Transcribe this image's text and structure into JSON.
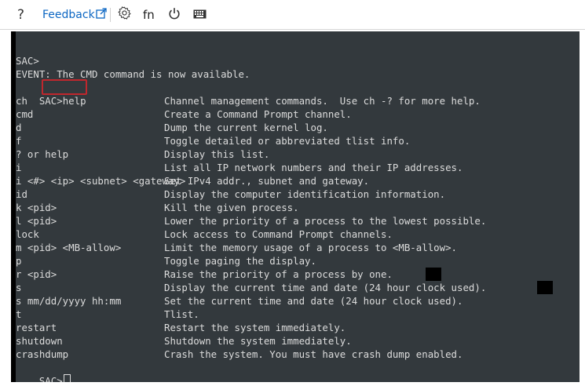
{
  "toolbar": {
    "help_label": "?",
    "feedback_label": "Feedback",
    "fn_label": "fn"
  },
  "terminal": {
    "pre_lines": [
      "SAC>",
      "EVENT: The CMD command is now available."
    ],
    "prompt": "SAC>",
    "typed_command": "help",
    "help_rows": [
      {
        "cmd": "ch",
        "desc": "Channel management commands.  Use ch -? for more help."
      },
      {
        "cmd": "cmd",
        "desc": "Create a Command Prompt channel."
      },
      {
        "cmd": "d",
        "desc": "Dump the current kernel log."
      },
      {
        "cmd": "f",
        "desc": "Toggle detailed or abbreviated tlist info."
      },
      {
        "cmd": "? or help",
        "desc": "Display this list."
      },
      {
        "cmd": "i",
        "desc": "List all IP network numbers and their IP addresses."
      },
      {
        "cmd": "i <#> <ip> <subnet> <gateway>",
        "desc": "Set IPv4 addr., subnet and gateway."
      },
      {
        "cmd": "id",
        "desc": "Display the computer identification information."
      },
      {
        "cmd": "k <pid>",
        "desc": "Kill the given process."
      },
      {
        "cmd": "l <pid>",
        "desc": "Lower the priority of a process to the lowest possible."
      },
      {
        "cmd": "lock",
        "desc": "Lock access to Command Prompt channels."
      },
      {
        "cmd": "m <pid> <MB-allow>",
        "desc": "Limit the memory usage of a process to <MB-allow>."
      },
      {
        "cmd": "p",
        "desc": "Toggle paging the display."
      },
      {
        "cmd": "r <pid>",
        "desc": "Raise the priority of a process by one."
      },
      {
        "cmd": "s",
        "desc": "Display the current time and date (24 hour clock used)."
      },
      {
        "cmd": "s mm/dd/yyyy hh:mm",
        "desc": "Set the current time and date (24 hour clock used)."
      },
      {
        "cmd": "t",
        "desc": "Tlist."
      },
      {
        "cmd": "restart",
        "desc": "Restart the system immediately."
      },
      {
        "cmd": "shutdown",
        "desc": "Shutdown the system immediately."
      },
      {
        "cmd": "crashdump",
        "desc": "Crash the system. You must have crash dump enabled."
      }
    ],
    "final_prompt": "SAC>"
  },
  "colors": {
    "terminal_bg": "#33393d",
    "terminal_text": "#dcdcdc",
    "highlight_border": "#c0272d",
    "link": "#0b66c3"
  },
  "icons": [
    "help-icon",
    "external-link-icon",
    "gear-icon",
    "power-icon",
    "keyboard-icon"
  ]
}
